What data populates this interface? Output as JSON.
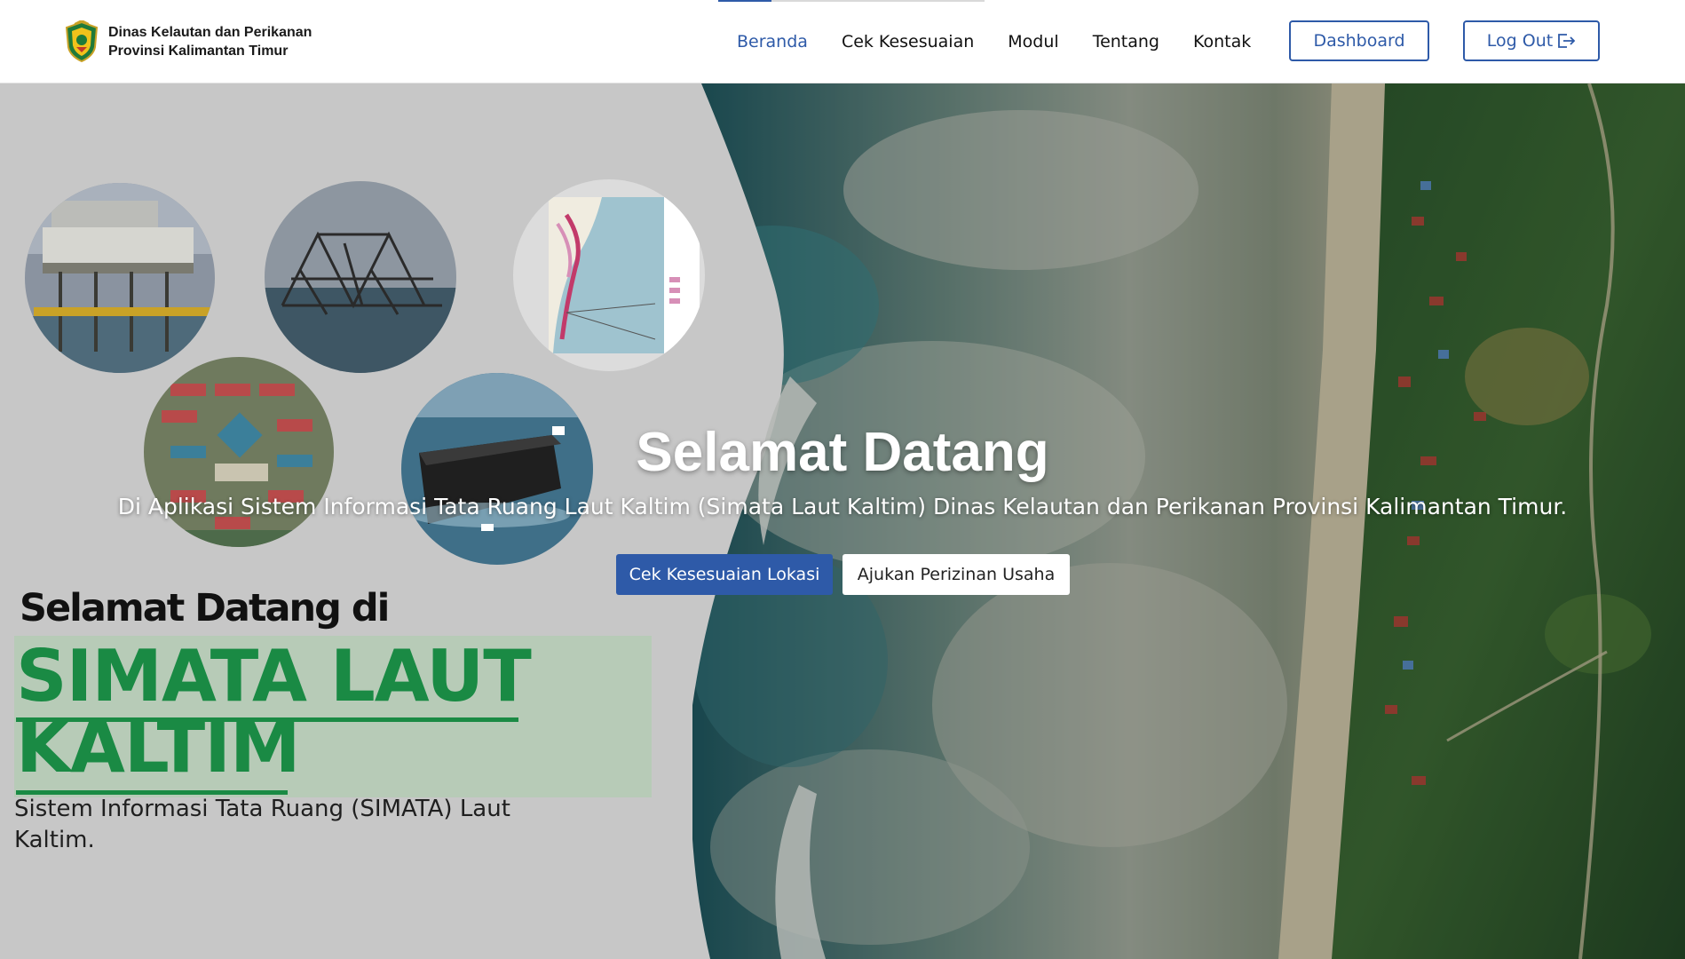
{
  "brand": {
    "line1": "Dinas Kelautan dan Perikanan",
    "line2": "Provinsi Kalimantan Timur",
    "logo_icon": "provincial-emblem-icon"
  },
  "nav": {
    "items": [
      {
        "label": "Beranda",
        "active": true
      },
      {
        "label": "Cek Kesesuaian",
        "active": false
      },
      {
        "label": "Modul",
        "active": false
      },
      {
        "label": "Tentang",
        "active": false
      },
      {
        "label": "Kontak",
        "active": false
      }
    ],
    "dashboard_label": "Dashboard",
    "logout_label": "Log Out",
    "logout_icon": "logout-icon"
  },
  "hero": {
    "title": "Selamat Datang",
    "subtitle": "Di Aplikasi Sistem Informasi Tata Ruang Laut Kaltim (Simata Laut Kaltim) Dinas Kelautan dan Perikanan Provinsi Kalimantan Timur.",
    "primary_button": "Cek Kesesuaian Lokasi",
    "secondary_button": "Ajukan Perizinan Usaha"
  },
  "promo": {
    "heading": "Selamat Datang di",
    "title_line1": "SIMATA LAUT",
    "title_line2": "KALTIM",
    "description": "Sistem Informasi Tata Ruang (SIMATA) Laut Kaltim."
  },
  "colors": {
    "accent": "#2e5aa8",
    "promo_green": "#1a8a44"
  }
}
